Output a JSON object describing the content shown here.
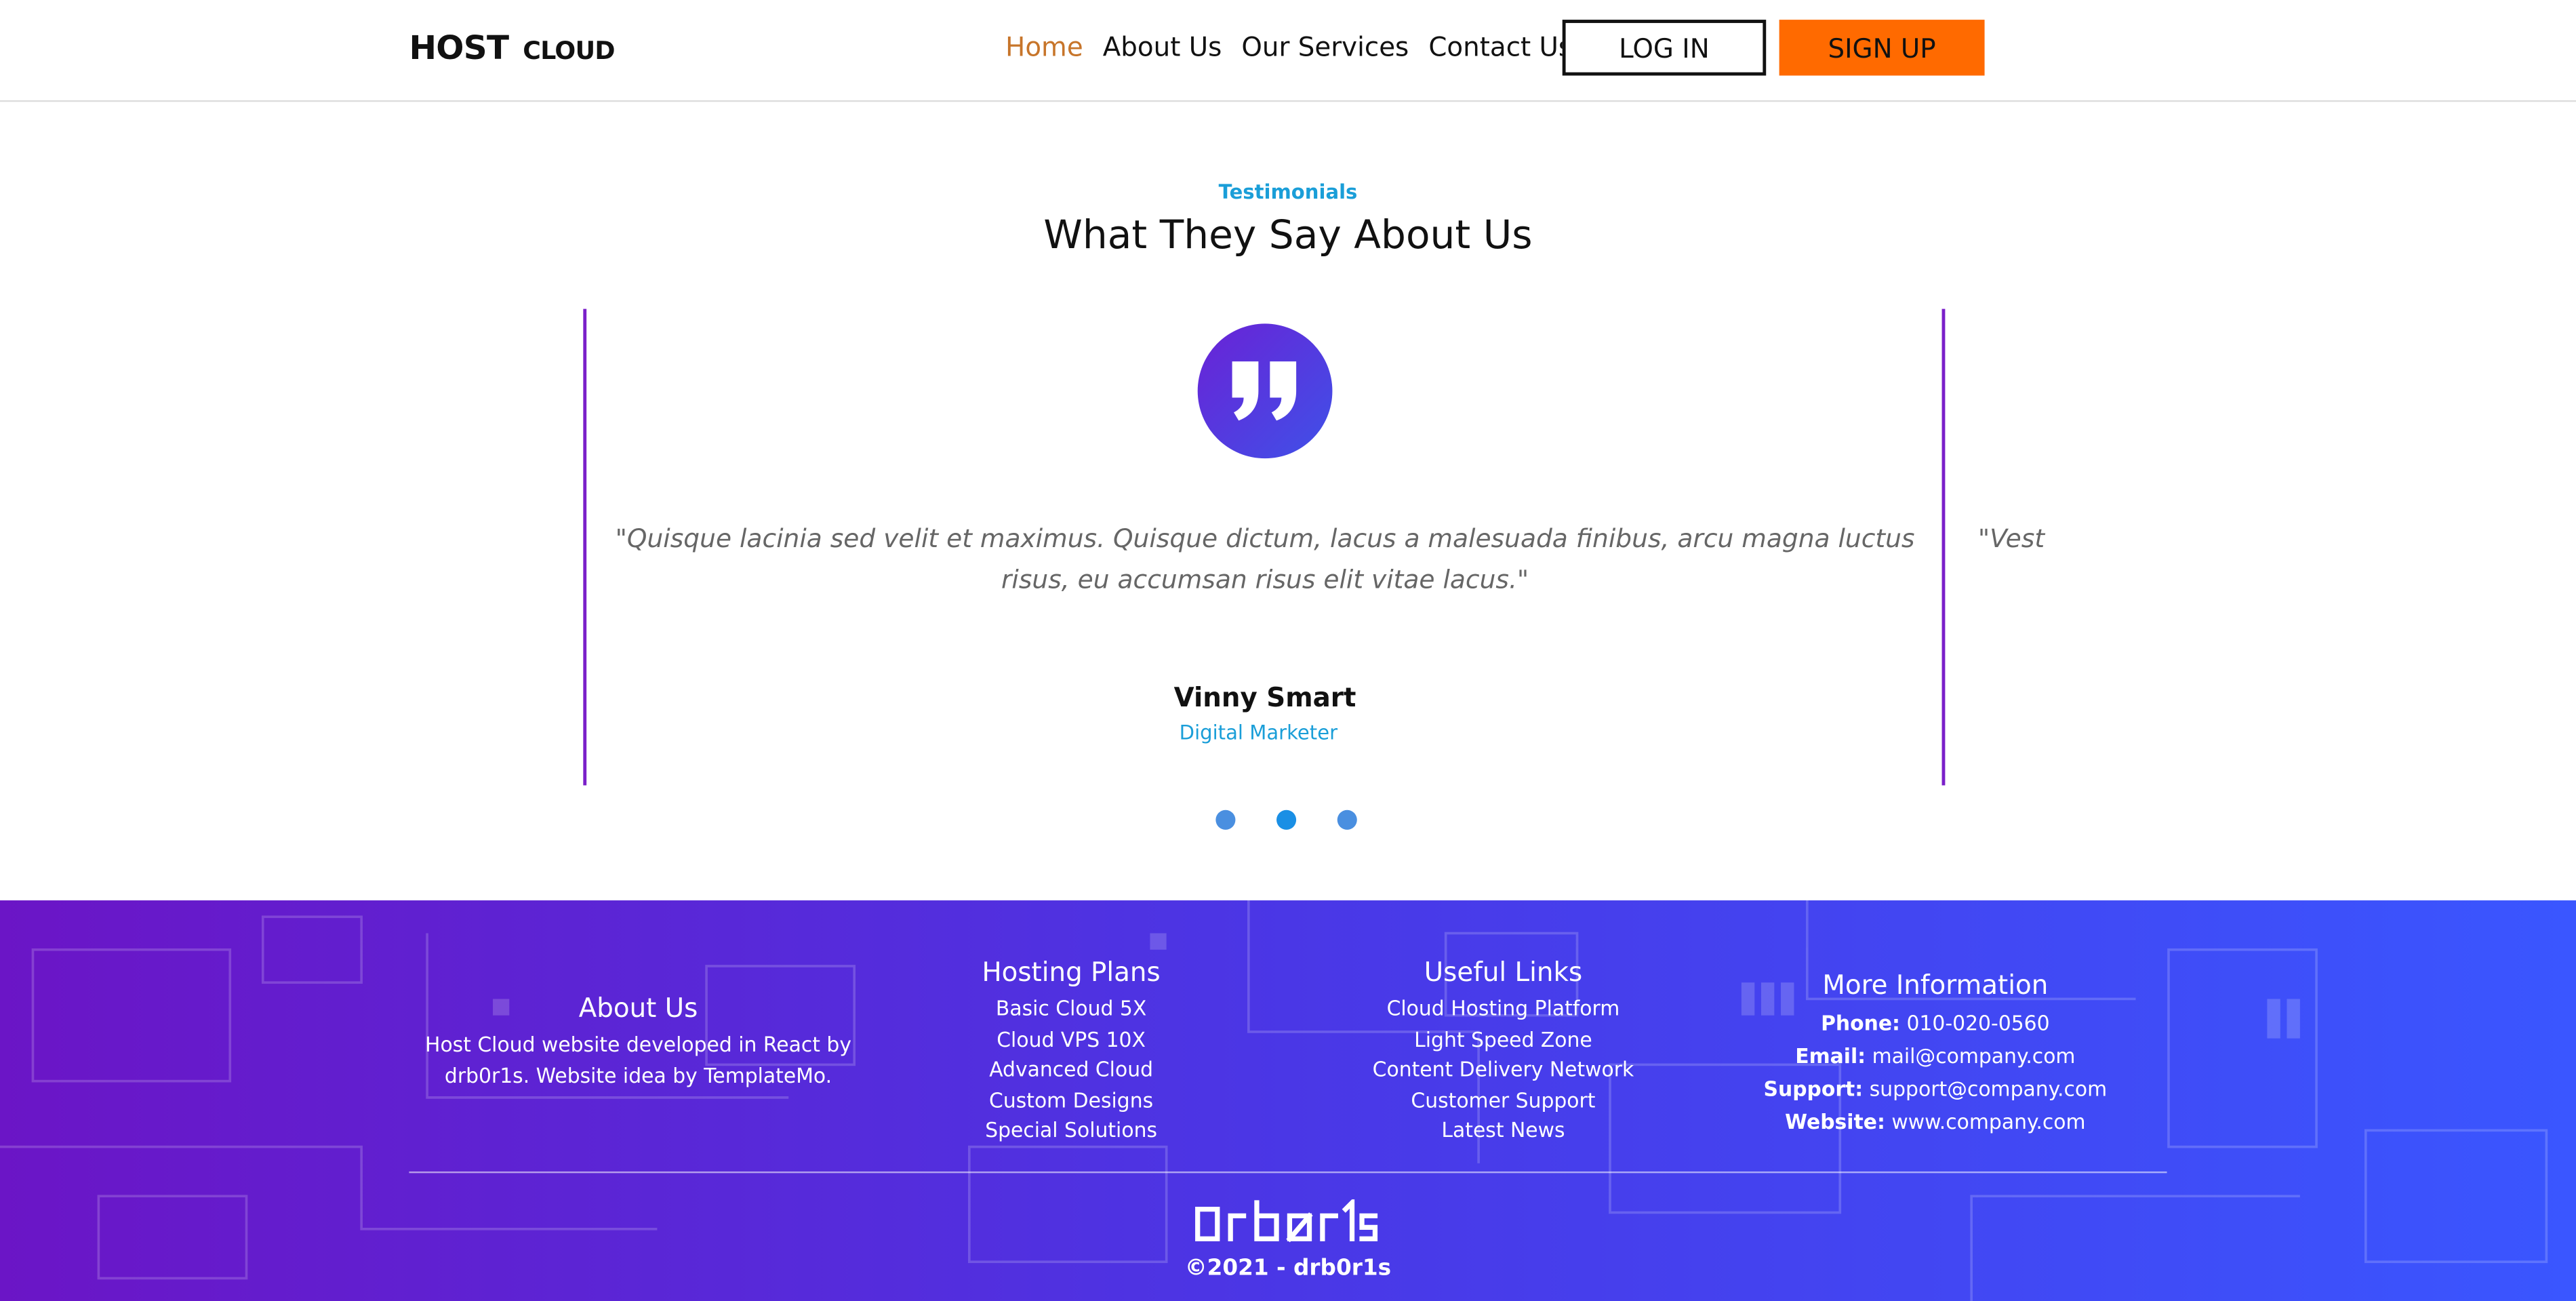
{
  "header": {
    "logo_main": "HOST",
    "logo_small": "CLOUD",
    "nav": [
      {
        "label": "Home",
        "active": true
      },
      {
        "label": "About Us",
        "active": false
      },
      {
        "label": "Our Services",
        "active": false
      },
      {
        "label": "Contact Us",
        "active": false
      }
    ],
    "login_label": "LOG IN",
    "signup_label": "SIGN UP"
  },
  "testimonials": {
    "eyebrow": "Testimonials",
    "title": "What They Say About Us",
    "quote": "\"Quisque lacinia sed velit et maximus. Quisque dictum, lacus a malesuada finibus, arcu magna luctus risus, eu accumsan risus elit vitae lacus.\"",
    "next_quote_peek": "\"Vest",
    "author_name": "Vinny Smart",
    "author_role": "Digital Marketer",
    "active_dot": 2,
    "dot_count": 3
  },
  "footer": {
    "about": {
      "title": "About Us",
      "text": "Host Cloud website developed in React by drb0r1s. Website idea by TemplateMo."
    },
    "hosting": {
      "title": "Hosting Plans",
      "items": [
        "Basic Cloud 5X",
        "Cloud VPS 10X",
        "Advanced Cloud",
        "Custom Designs",
        "Special Solutions"
      ]
    },
    "useful": {
      "title": "Useful Links",
      "items": [
        "Cloud Hosting Platform",
        "Light Speed Zone",
        "Content Delivery Network",
        "Customer Support",
        "Latest News"
      ]
    },
    "more": {
      "title": "More Information",
      "phone_label": "Phone:",
      "phone": "010-020-0560",
      "email_label": "Email:",
      "email": "mail@company.com",
      "support_label": "Support:",
      "support": "support@company.com",
      "website_label": "Website:",
      "website": "www.company.com"
    },
    "brand": "drb0r1s",
    "copyright": "©2021 - drb0r1s"
  },
  "colors": {
    "accent_orange": "#ff6a00",
    "active_nav": "#c7752a",
    "accent_blue": "#1a9ed8",
    "slider_line": "#7a1fc9",
    "footer_gradient_start": "#6b15c6",
    "footer_gradient_end": "#3a56ff"
  },
  "icons": {
    "quote": "quote-icon"
  }
}
